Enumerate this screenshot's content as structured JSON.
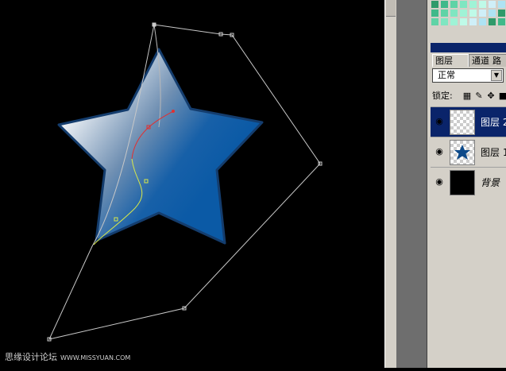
{
  "panels": {
    "tabs": [
      "图层",
      "通道",
      "路"
    ],
    "blend_mode": "正常",
    "lock_label": "锁定:",
    "layers": [
      {
        "name": "图层 2",
        "selected": true,
        "thumb": "transparent-checker"
      },
      {
        "name": "图层 1",
        "selected": false,
        "thumb": "star-on-checker"
      },
      {
        "name": "背景",
        "selected": false,
        "thumb": "black-fill"
      }
    ]
  },
  "watermark": {
    "text": "思缘设计论坛",
    "url": "WWW.MISSYUAN.COM"
  },
  "colors": {
    "star_light": "#dfe7ef",
    "star_dark": "#0d5aa7",
    "path_red": "#e23030",
    "path_yellow": "#d8e84a",
    "selection": "#0a246a"
  }
}
